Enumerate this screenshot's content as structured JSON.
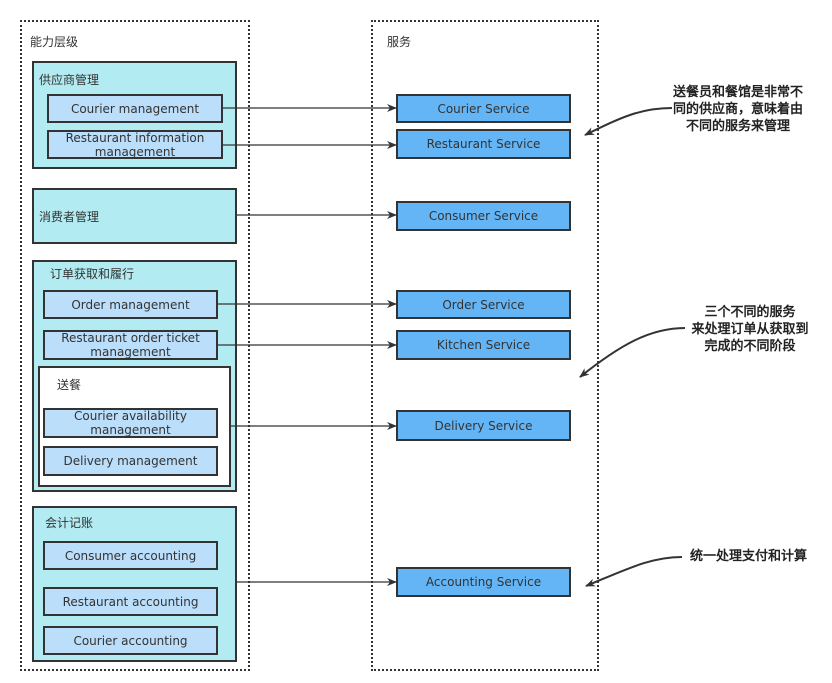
{
  "capabilities": {
    "title": "能力层级",
    "groups": [
      {
        "label": "供应商管理",
        "items": [
          "Courier management",
          "Restaurant information management"
        ]
      },
      {
        "label": "消费者管理",
        "items": []
      },
      {
        "label": "订单获取和履行",
        "items": [
          "Order management",
          "Restaurant order ticket management"
        ],
        "subgroup": {
          "label": "送餐",
          "items": [
            "Courier availability management",
            "Delivery management"
          ]
        }
      },
      {
        "label": "会计记账",
        "items": [
          "Consumer accounting",
          "Restaurant accounting",
          "Courier accounting"
        ]
      }
    ]
  },
  "services": {
    "title": "服务",
    "items": [
      "Courier Service",
      "Restaurant Service",
      "Consumer Service",
      "Order Service",
      "Kitchen Service",
      "Delivery Service",
      "Accounting Service"
    ]
  },
  "annotations": [
    {
      "lines": [
        "送餐员和餐馆是非常不",
        "同的供应商，意味着由",
        "不同的服务来管理"
      ]
    },
    {
      "lines": [
        "三个不同的服务",
        "来处理订单从获取到",
        "完成的不同阶段"
      ]
    },
    {
      "lines": [
        "统一处理支付和计算"
      ]
    }
  ],
  "colors": {
    "group_fill": "#b2ebf2",
    "capability_fill": "#bbdefb",
    "service_fill": "#64b5f6",
    "stroke": "#333333"
  }
}
